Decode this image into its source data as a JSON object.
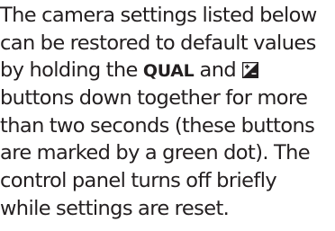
{
  "document": {
    "lines": [
      "The camera settings listed below",
      "can be restored to default values",
      "by holding the ",
      "QUAL",
      " and ",
      "buttons down together for more",
      "than two seconds (these buttons",
      "are marked by a green dot).  The",
      "control panel turns off briefly",
      "while settings are reset."
    ],
    "icon": "exposure-compensation-icon"
  }
}
